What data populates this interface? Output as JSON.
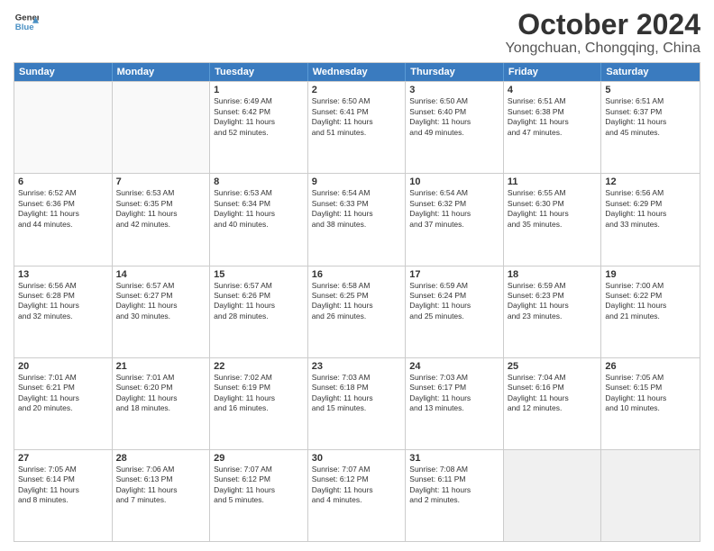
{
  "logo": {
    "line1": "General",
    "line2": "Blue"
  },
  "title": "October 2024",
  "subtitle": "Yongchuan, Chongqing, China",
  "days_of_week": [
    "Sunday",
    "Monday",
    "Tuesday",
    "Wednesday",
    "Thursday",
    "Friday",
    "Saturday"
  ],
  "weeks": [
    [
      {
        "day": "",
        "empty": true,
        "lines": []
      },
      {
        "day": "",
        "empty": true,
        "lines": []
      },
      {
        "day": "1",
        "lines": [
          "Sunrise: 6:49 AM",
          "Sunset: 6:42 PM",
          "Daylight: 11 hours",
          "and 52 minutes."
        ]
      },
      {
        "day": "2",
        "lines": [
          "Sunrise: 6:50 AM",
          "Sunset: 6:41 PM",
          "Daylight: 11 hours",
          "and 51 minutes."
        ]
      },
      {
        "day": "3",
        "lines": [
          "Sunrise: 6:50 AM",
          "Sunset: 6:40 PM",
          "Daylight: 11 hours",
          "and 49 minutes."
        ]
      },
      {
        "day": "4",
        "lines": [
          "Sunrise: 6:51 AM",
          "Sunset: 6:38 PM",
          "Daylight: 11 hours",
          "and 47 minutes."
        ]
      },
      {
        "day": "5",
        "lines": [
          "Sunrise: 6:51 AM",
          "Sunset: 6:37 PM",
          "Daylight: 11 hours",
          "and 45 minutes."
        ]
      }
    ],
    [
      {
        "day": "6",
        "lines": [
          "Sunrise: 6:52 AM",
          "Sunset: 6:36 PM",
          "Daylight: 11 hours",
          "and 44 minutes."
        ]
      },
      {
        "day": "7",
        "lines": [
          "Sunrise: 6:53 AM",
          "Sunset: 6:35 PM",
          "Daylight: 11 hours",
          "and 42 minutes."
        ]
      },
      {
        "day": "8",
        "lines": [
          "Sunrise: 6:53 AM",
          "Sunset: 6:34 PM",
          "Daylight: 11 hours",
          "and 40 minutes."
        ]
      },
      {
        "day": "9",
        "lines": [
          "Sunrise: 6:54 AM",
          "Sunset: 6:33 PM",
          "Daylight: 11 hours",
          "and 38 minutes."
        ]
      },
      {
        "day": "10",
        "lines": [
          "Sunrise: 6:54 AM",
          "Sunset: 6:32 PM",
          "Daylight: 11 hours",
          "and 37 minutes."
        ]
      },
      {
        "day": "11",
        "lines": [
          "Sunrise: 6:55 AM",
          "Sunset: 6:30 PM",
          "Daylight: 11 hours",
          "and 35 minutes."
        ]
      },
      {
        "day": "12",
        "lines": [
          "Sunrise: 6:56 AM",
          "Sunset: 6:29 PM",
          "Daylight: 11 hours",
          "and 33 minutes."
        ]
      }
    ],
    [
      {
        "day": "13",
        "lines": [
          "Sunrise: 6:56 AM",
          "Sunset: 6:28 PM",
          "Daylight: 11 hours",
          "and 32 minutes."
        ]
      },
      {
        "day": "14",
        "lines": [
          "Sunrise: 6:57 AM",
          "Sunset: 6:27 PM",
          "Daylight: 11 hours",
          "and 30 minutes."
        ]
      },
      {
        "day": "15",
        "lines": [
          "Sunrise: 6:57 AM",
          "Sunset: 6:26 PM",
          "Daylight: 11 hours",
          "and 28 minutes."
        ]
      },
      {
        "day": "16",
        "lines": [
          "Sunrise: 6:58 AM",
          "Sunset: 6:25 PM",
          "Daylight: 11 hours",
          "and 26 minutes."
        ]
      },
      {
        "day": "17",
        "lines": [
          "Sunrise: 6:59 AM",
          "Sunset: 6:24 PM",
          "Daylight: 11 hours",
          "and 25 minutes."
        ]
      },
      {
        "day": "18",
        "lines": [
          "Sunrise: 6:59 AM",
          "Sunset: 6:23 PM",
          "Daylight: 11 hours",
          "and 23 minutes."
        ]
      },
      {
        "day": "19",
        "lines": [
          "Sunrise: 7:00 AM",
          "Sunset: 6:22 PM",
          "Daylight: 11 hours",
          "and 21 minutes."
        ]
      }
    ],
    [
      {
        "day": "20",
        "lines": [
          "Sunrise: 7:01 AM",
          "Sunset: 6:21 PM",
          "Daylight: 11 hours",
          "and 20 minutes."
        ]
      },
      {
        "day": "21",
        "lines": [
          "Sunrise: 7:01 AM",
          "Sunset: 6:20 PM",
          "Daylight: 11 hours",
          "and 18 minutes."
        ]
      },
      {
        "day": "22",
        "lines": [
          "Sunrise: 7:02 AM",
          "Sunset: 6:19 PM",
          "Daylight: 11 hours",
          "and 16 minutes."
        ]
      },
      {
        "day": "23",
        "lines": [
          "Sunrise: 7:03 AM",
          "Sunset: 6:18 PM",
          "Daylight: 11 hours",
          "and 15 minutes."
        ]
      },
      {
        "day": "24",
        "lines": [
          "Sunrise: 7:03 AM",
          "Sunset: 6:17 PM",
          "Daylight: 11 hours",
          "and 13 minutes."
        ]
      },
      {
        "day": "25",
        "lines": [
          "Sunrise: 7:04 AM",
          "Sunset: 6:16 PM",
          "Daylight: 11 hours",
          "and 12 minutes."
        ]
      },
      {
        "day": "26",
        "lines": [
          "Sunrise: 7:05 AM",
          "Sunset: 6:15 PM",
          "Daylight: 11 hours",
          "and 10 minutes."
        ]
      }
    ],
    [
      {
        "day": "27",
        "lines": [
          "Sunrise: 7:05 AM",
          "Sunset: 6:14 PM",
          "Daylight: 11 hours",
          "and 8 minutes."
        ]
      },
      {
        "day": "28",
        "lines": [
          "Sunrise: 7:06 AM",
          "Sunset: 6:13 PM",
          "Daylight: 11 hours",
          "and 7 minutes."
        ]
      },
      {
        "day": "29",
        "lines": [
          "Sunrise: 7:07 AM",
          "Sunset: 6:12 PM",
          "Daylight: 11 hours",
          "and 5 minutes."
        ]
      },
      {
        "day": "30",
        "lines": [
          "Sunrise: 7:07 AM",
          "Sunset: 6:12 PM",
          "Daylight: 11 hours",
          "and 4 minutes."
        ]
      },
      {
        "day": "31",
        "lines": [
          "Sunrise: 7:08 AM",
          "Sunset: 6:11 PM",
          "Daylight: 11 hours",
          "and 2 minutes."
        ]
      },
      {
        "day": "",
        "empty": true,
        "shaded": true,
        "lines": []
      },
      {
        "day": "",
        "empty": true,
        "shaded": true,
        "lines": []
      }
    ]
  ]
}
